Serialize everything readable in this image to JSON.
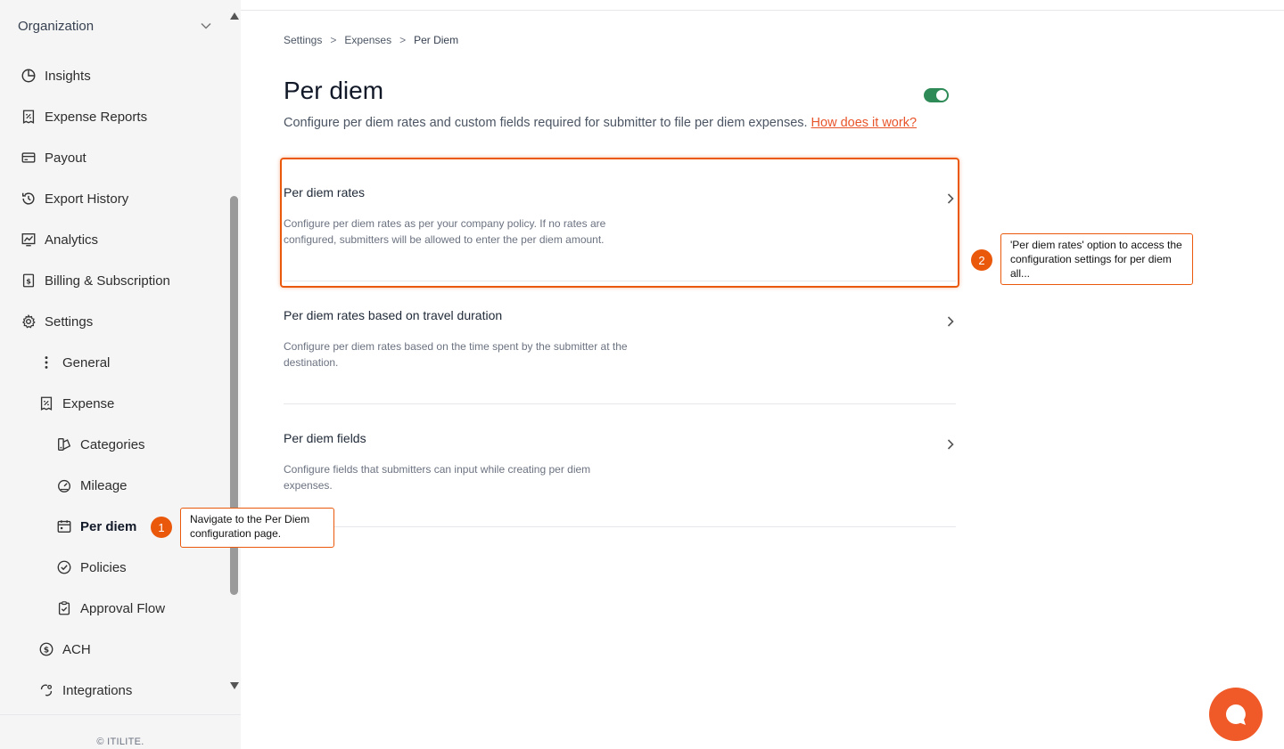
{
  "sidebar": {
    "org_label": "Organization",
    "items": [
      {
        "label": "Insights",
        "icon": "pie-chart-icon"
      },
      {
        "label": "Expense Reports",
        "icon": "receipt-percent-icon"
      },
      {
        "label": "Payout",
        "icon": "card-icon"
      },
      {
        "label": "Export History",
        "icon": "history-icon"
      },
      {
        "label": "Analytics",
        "icon": "chart-icon"
      },
      {
        "label": "Billing & Subscription",
        "icon": "invoice-dollar-icon"
      },
      {
        "label": "Settings",
        "icon": "gear-icon"
      },
      {
        "label": "General",
        "icon": "vertical-dots-icon"
      },
      {
        "label": "Expense",
        "icon": "receipt-percent-icon"
      },
      {
        "label": "Categories",
        "icon": "categories-icon"
      },
      {
        "label": "Mileage",
        "icon": "gauge-icon"
      },
      {
        "label": "Per diem",
        "icon": "calendar-icon"
      },
      {
        "label": "Policies",
        "icon": "check-circle-icon"
      },
      {
        "label": "Approval Flow",
        "icon": "clipboard-check-icon"
      },
      {
        "label": "ACH",
        "icon": "dollar-circle-icon"
      },
      {
        "label": "Integrations",
        "icon": "integrations-icon"
      }
    ],
    "footer": "© ITILITE."
  },
  "breadcrumb": [
    "Settings",
    "Expenses",
    "Per Diem"
  ],
  "breadcrumb_sep": ">",
  "page": {
    "title": "Per diem",
    "subtitle": "Configure per diem rates and custom fields required for submitter to file per diem expenses.",
    "help_link": "How does it work?",
    "toggle_on": true
  },
  "cards": [
    {
      "title": "Per diem rates",
      "desc": "Configure per diem rates as per your company policy. If no rates are configured, submitters will be allowed to enter the per diem amount."
    },
    {
      "title": "Per diem rates based on travel duration",
      "desc": "Configure per diem rates based on the time spent by the submitter at the destination."
    },
    {
      "title": "Per diem fields",
      "desc": "Configure fields that submitters can input while creating per diem expenses."
    }
  ],
  "callouts": [
    {
      "number": "1",
      "text": "Navigate to the Per Diem configuration page."
    },
    {
      "number": "2",
      "text": "'Per diem rates' option to access the configuration settings for per diem all..."
    }
  ],
  "colors": {
    "accent": "#ea580c",
    "toggle": "#2e8b57",
    "chat": "#ef5a28"
  }
}
